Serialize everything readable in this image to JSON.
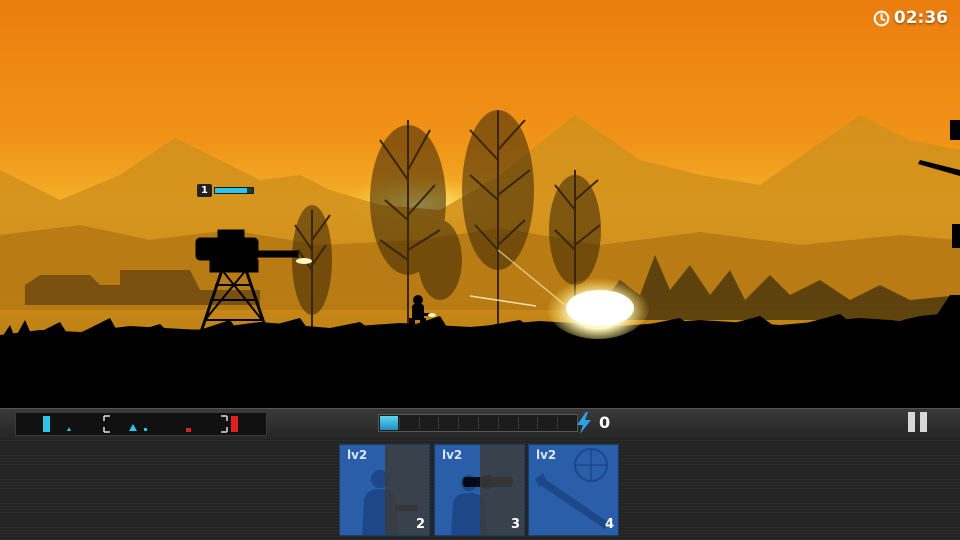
{
  "hud": {
    "timer": "02:36",
    "energy_count": "0",
    "energy_fill": 0.1
  },
  "unit_tag": {
    "level": "1",
    "health_fraction": 0.85
  },
  "cards": [
    {
      "level": "lv2",
      "cost": "2",
      "unit": "rifleman",
      "cooldown_fraction": 0.5
    },
    {
      "level": "lv2",
      "cost": "3",
      "unit": "rocket-soldier",
      "cooldown_fraction": 0.5
    },
    {
      "level": "lv2",
      "cost": "4",
      "unit": "missile-strike",
      "cooldown_fraction": 0.0
    }
  ],
  "colors": {
    "sky_top": "#f08a10",
    "sky_mid": "#e27a12",
    "horizon": "#f6c030",
    "accent_cyan": "#2ec6e8",
    "enemy_red": "#e02020",
    "card_blue": "#2a5ea8"
  },
  "icons": [
    "clock-icon",
    "lightning-icon",
    "pause-icon"
  ]
}
